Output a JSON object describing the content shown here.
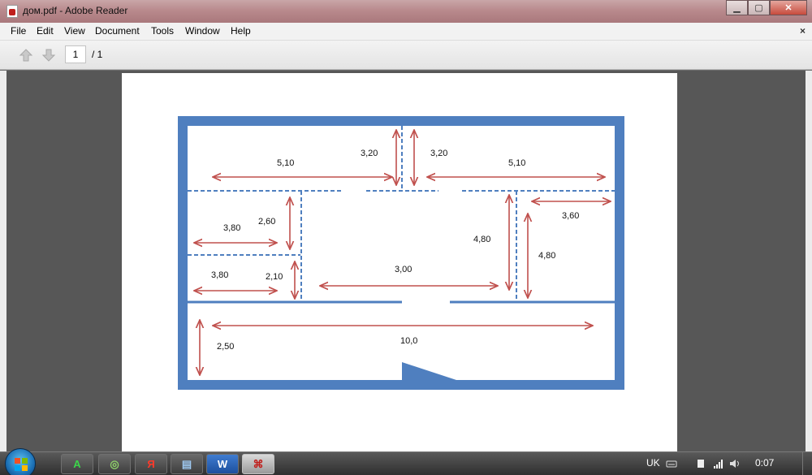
{
  "window": {
    "title": "дом.pdf - Adobe Reader",
    "min_label": "▁",
    "max_label": "▢",
    "close_label": "✕"
  },
  "menu": {
    "items": [
      "File",
      "Edit",
      "View",
      "Document",
      "Tools",
      "Window",
      "Help"
    ],
    "close_label": "×"
  },
  "toolbar": {
    "current_page": "1",
    "total_pages": "/ 1",
    "prev_icon": "arrow-up-icon",
    "next_icon": "arrow-down-icon"
  },
  "floor_plan": {
    "dimensions": {
      "top_left_width": "5,10",
      "top_center_left_height": "3,20",
      "top_center_right_height": "3,20",
      "top_right_width": "5,10",
      "room_a_width": "3,80",
      "room_a_height": "2,60",
      "room_b_width": "3,80",
      "room_b_height": "2,10",
      "center_width": "3,00",
      "right_room_height_left": "4,80",
      "right_room_width": "3,60",
      "right_room_height_right": "4,80",
      "corridor_length": "10,0",
      "corridor_width": "2,50"
    },
    "colors": {
      "wall": "#4f7fbf",
      "arrow": "#c0504d"
    }
  },
  "taskbar": {
    "apps": [
      {
        "name": "acrobat-a-icon",
        "label": "A"
      },
      {
        "name": "picasa-icon",
        "label": "◎"
      },
      {
        "name": "yandex-icon",
        "label": "Я"
      },
      {
        "name": "notepad-icon",
        "label": "▤"
      },
      {
        "name": "word-icon",
        "label": "W"
      },
      {
        "name": "adobe-reader-icon",
        "label": "⌘"
      }
    ],
    "language": "UK",
    "clock": "0:07"
  }
}
